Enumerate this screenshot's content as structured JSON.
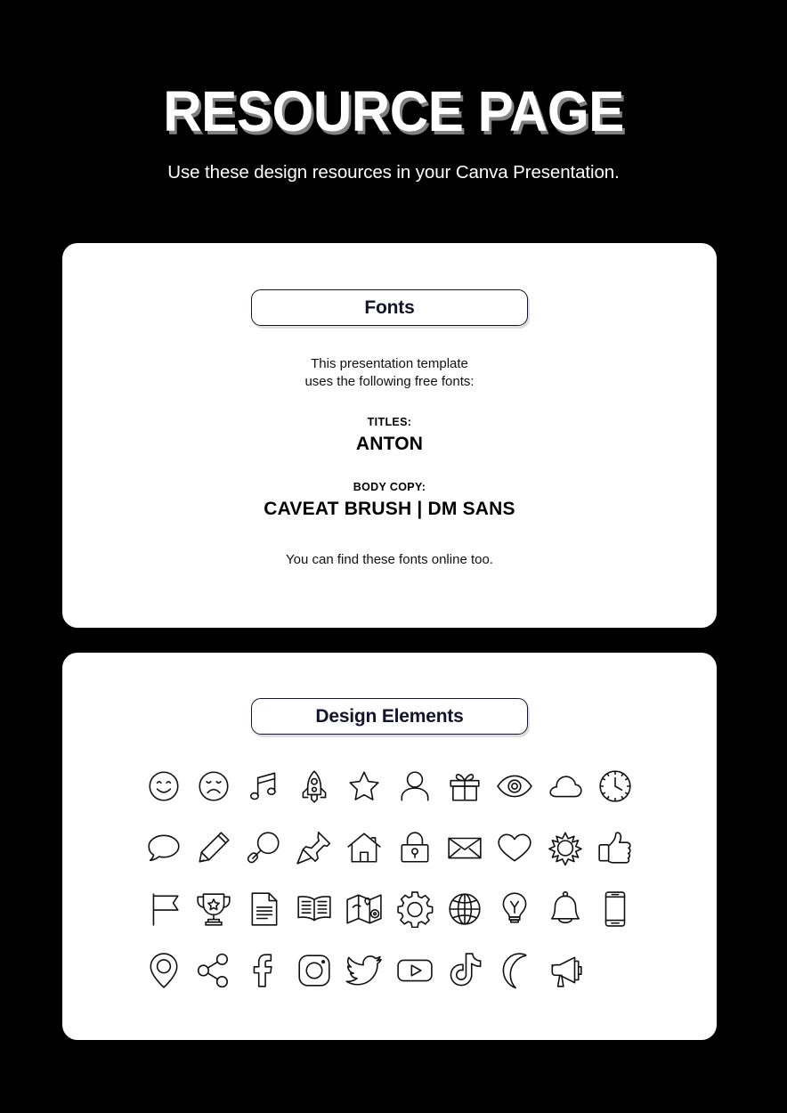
{
  "header": {
    "title": "RESOURCE PAGE",
    "subtitle": "Use these design resources in your Canva Presentation."
  },
  "theme": {
    "background": "#000000",
    "card_background": "#ffffff",
    "text_dark": "#14142b",
    "text_body": "#111111",
    "title_shadow": "#969696"
  },
  "fonts_card": {
    "pill_label": "Fonts",
    "intro_line1": "This presentation template",
    "intro_line2": "uses the following free fonts:",
    "groups": [
      {
        "label": "TITLES:",
        "value": "ANTON"
      },
      {
        "label": "BODY COPY:",
        "value": "CAVEAT BRUSH   |   DM SANS"
      }
    ],
    "footer": "You can find these fonts online too."
  },
  "elements_card": {
    "pill_label": "Design Elements",
    "icons": [
      "smiley-face-icon",
      "sad-face-icon",
      "music-note-icon",
      "rocket-icon",
      "star-icon",
      "user-person-icon",
      "gift-icon",
      "eye-icon",
      "cloud-icon",
      "clock-icon",
      "speech-bubble-icon",
      "pencil-icon",
      "magnifying-glass-icon",
      "pushpin-icon",
      "house-icon",
      "padlock-icon",
      "envelope-icon",
      "heart-icon",
      "sun-icon",
      "thumbs-up-icon",
      "flag-icon",
      "trophy-icon",
      "document-icon",
      "open-book-icon",
      "map-icon",
      "gear-icon",
      "globe-icon",
      "lightbulb-icon",
      "bell-icon",
      "smartphone-icon",
      "location-pin-icon",
      "share-icon",
      "facebook-icon",
      "instagram-icon",
      "twitter-icon",
      "youtube-icon",
      "tiktok-icon",
      "moon-icon",
      "megaphone-icon"
    ]
  }
}
